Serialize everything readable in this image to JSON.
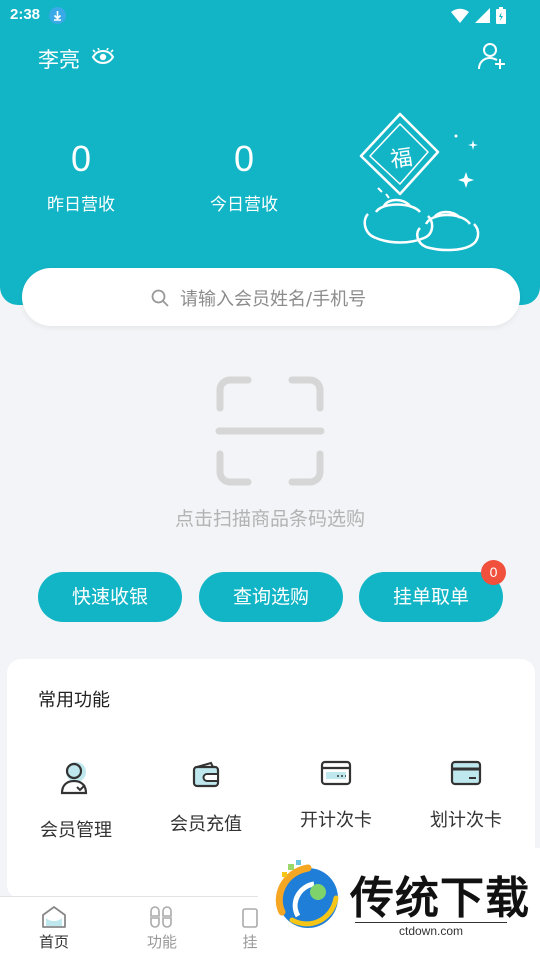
{
  "status_bar": {
    "time": "2:38"
  },
  "header": {
    "user_name": "李亮",
    "stats": [
      {
        "value": "0",
        "label": "昨日营收"
      },
      {
        "value": "0",
        "label": "今日营收"
      }
    ]
  },
  "search": {
    "placeholder": "请输入会员姓名/手机号"
  },
  "scan": {
    "hint": "点击扫描商品条码选购"
  },
  "actions": {
    "quick_checkout": "快速收银",
    "query_select": "查询选购",
    "hold_order": "挂单取单",
    "hold_badge": "0"
  },
  "functions": {
    "title": "常用功能",
    "items": [
      {
        "label": "会员管理",
        "icon": "member-icon"
      },
      {
        "label": "会员充值",
        "icon": "wallet-icon"
      },
      {
        "label": "开计次卡",
        "icon": "card-open-icon"
      },
      {
        "label": "划计次卡",
        "icon": "card-swipe-icon"
      }
    ]
  },
  "bottom_nav": [
    {
      "label": "首页",
      "icon": "home-icon"
    },
    {
      "label": "功能",
      "icon": "grid-icon"
    },
    {
      "label": "挂",
      "icon": "third-icon"
    }
  ],
  "watermark": {
    "title": "传统下载",
    "url": "ctdown.com"
  },
  "colors": {
    "primary": "#12b5c6",
    "badge": "#f0503c",
    "background": "#f2f4f7"
  }
}
